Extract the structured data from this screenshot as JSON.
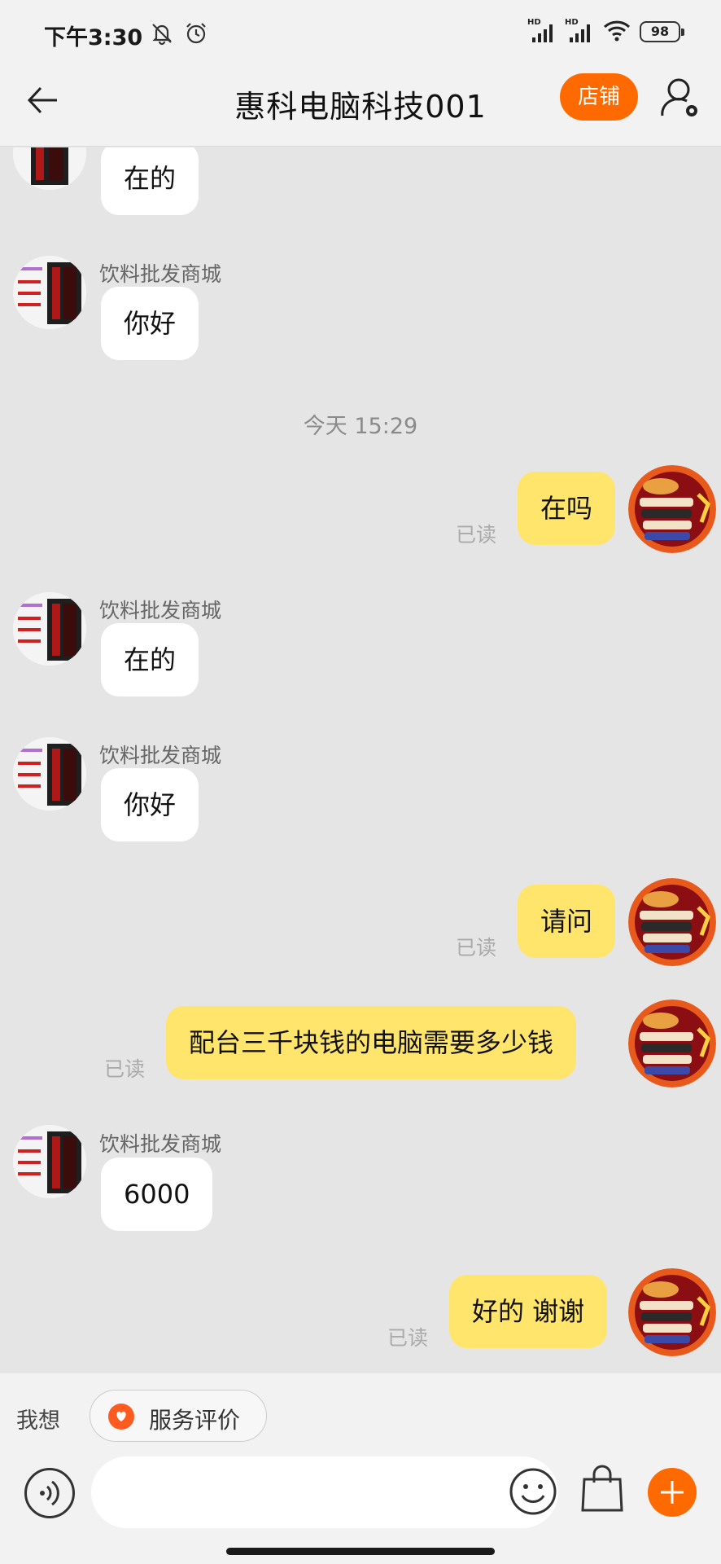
{
  "status_bar": {
    "time": "下午3:30",
    "signal_label_1": "HD",
    "signal_label_2": "HD",
    "battery": "98",
    "icons": [
      "mute-bell-icon",
      "alarm-clock-icon",
      "signal-icon",
      "signal-icon",
      "wifi-icon",
      "battery-icon"
    ]
  },
  "header": {
    "title": "惠科电脑科技001",
    "shop_label": "店铺",
    "accent_color": "#ff6a00"
  },
  "chat": {
    "messages": [
      {
        "from": "them",
        "text": "在的"
      },
      {
        "from": "them",
        "sender": "饮料批发商城",
        "text": "你好"
      },
      {
        "type": "time",
        "text": "今天  15:29"
      },
      {
        "from": "me",
        "text": "在吗",
        "status": "已读"
      },
      {
        "from": "them",
        "sender": "饮料批发商城",
        "text": "在的"
      },
      {
        "from": "them",
        "sender": "饮料批发商城",
        "text": "你好"
      },
      {
        "from": "me",
        "text": "请问",
        "status": "已读"
      },
      {
        "from": "me",
        "text": "配台三千块钱的电脑需要多少钱",
        "status": "已读"
      },
      {
        "from": "them",
        "sender": "饮料批发商城",
        "text": "6000"
      },
      {
        "from": "me",
        "text": "好的 谢谢",
        "status": "已读"
      }
    ],
    "outgoing_bubble_color": "#ffe56c",
    "incoming_bubble_color": "#ffffff"
  },
  "bottom": {
    "quick_label": "我想",
    "chip_label": "服务评价",
    "input_placeholder": ""
  }
}
